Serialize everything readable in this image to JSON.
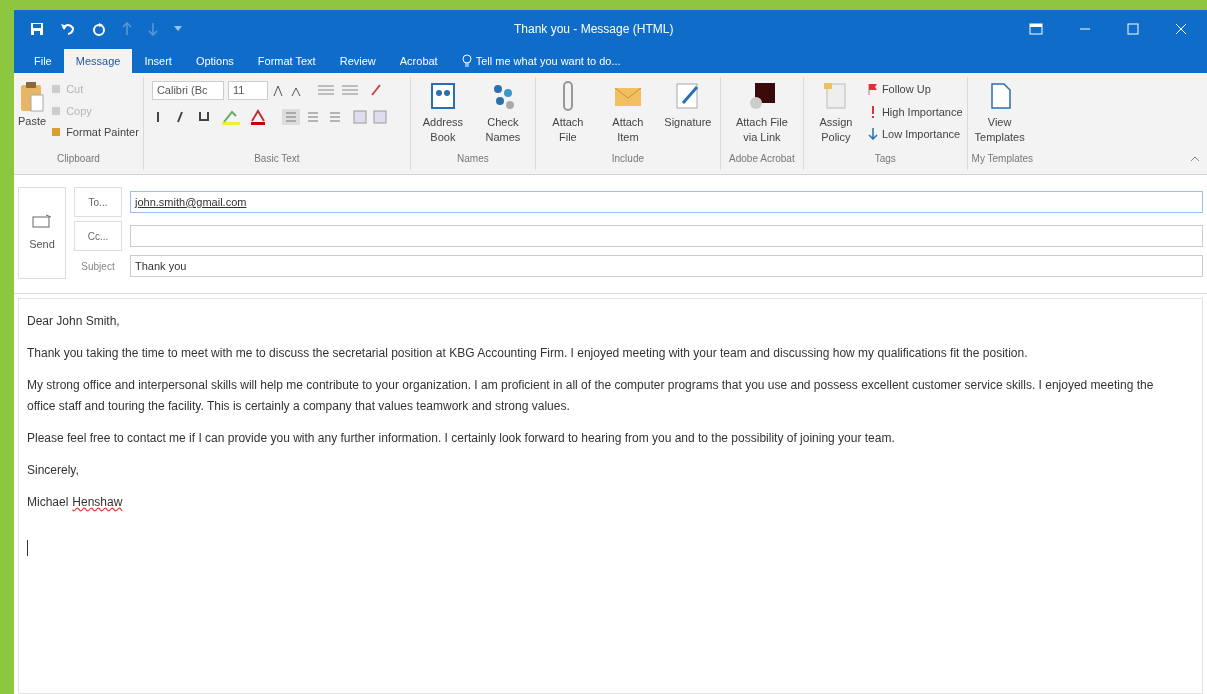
{
  "window": {
    "title": "Thank you - Message (HTML)"
  },
  "tabs": [
    {
      "label": "File",
      "selected": false
    },
    {
      "label": "Message",
      "selected": true
    },
    {
      "label": "Insert",
      "selected": false
    },
    {
      "label": "Options",
      "selected": false
    },
    {
      "label": "Format Text",
      "selected": false
    },
    {
      "label": "Review",
      "selected": false
    },
    {
      "label": "Acrobat",
      "selected": false
    }
  ],
  "tell_me": {
    "placeholder": "Tell me what you want to do..."
  },
  "ribbon": {
    "clipboard": {
      "label": "Clipboard",
      "paste": "Paste",
      "items": [
        {
          "label": "Cut",
          "disabled": true
        },
        {
          "label": "Copy",
          "disabled": true
        },
        {
          "label": "Format Painter",
          "disabled": false
        }
      ]
    },
    "basic_text": {
      "label": "Basic Text",
      "font": "Calibri (Bc",
      "size": "11"
    },
    "names": {
      "label": "Names",
      "buttons": [
        "Address Book",
        "Check Names"
      ]
    },
    "include": {
      "label": "Include",
      "buttons": [
        "Attach File",
        "Attach Item",
        "Signature"
      ]
    },
    "adobe": {
      "label": "Adobe Acrobat",
      "buttons": [
        "Attach File via Link"
      ]
    },
    "tags": {
      "label": "Tags",
      "assign": "Assign Policy",
      "items": [
        "Follow Up",
        "High Importance",
        "Low Importance"
      ]
    },
    "templates": {
      "label": "My Templates",
      "buttons": [
        "View Templates"
      ]
    }
  },
  "compose": {
    "send": "Send",
    "to_button": "To...",
    "cc_button": "Cc...",
    "to": "john.smith@gmail.com",
    "subject_label": "Subject",
    "subject": "Thank you"
  },
  "body": {
    "greeting": "Dear John Smith,",
    "paragraphs": [
      "Thank you taking the time to meet with me to discuss the secretarial position at KBG Accounting Firm. I enjoyed meeting with your team and discussing how my qualifications fit the position.",
      "My strong office and interpersonal skills will help me contribute to your organization. I am proficient in all of the computer programs that you use and possess excellent customer service skills. I enjoyed meeting the office staff and touring the facility. This is certainly a company that values teamwork and strong values.",
      "Please feel free to contact me if I can provide you with any further information. I certainly look forward to hearing from you and to the possibility of joining your team."
    ],
    "closing": "Sincerely,",
    "signature_first": "Michael",
    "signature_last": "Henshaw"
  }
}
